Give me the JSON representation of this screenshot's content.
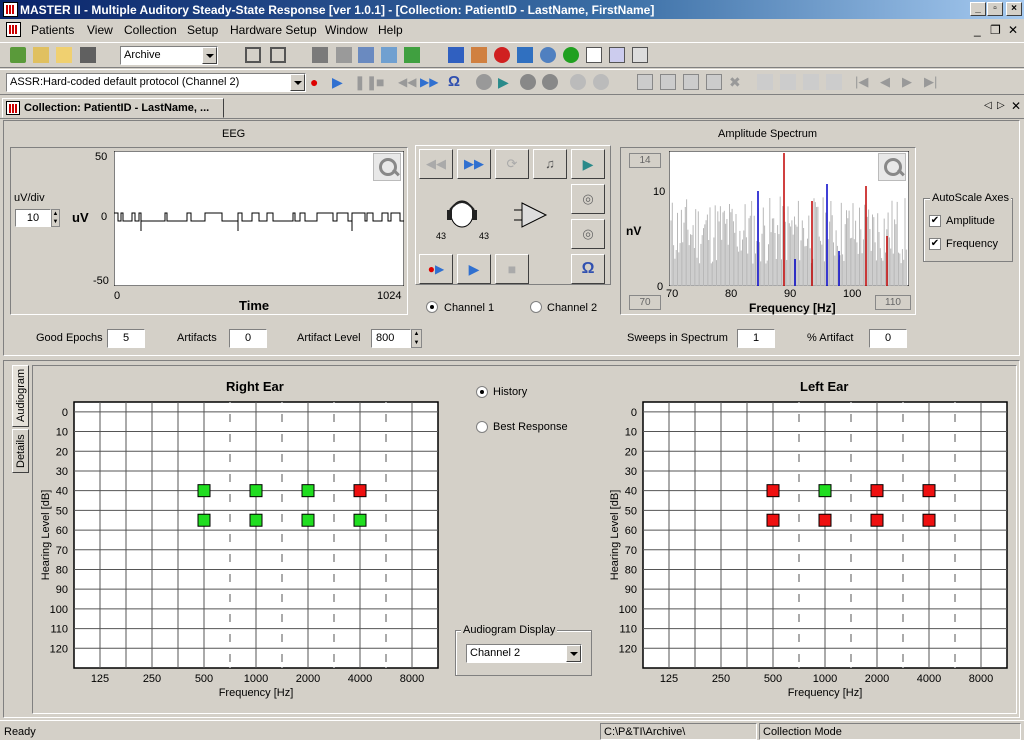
{
  "window": {
    "title": "MASTER II - Multiple Auditory Steady-State Response [ver 1.0.1] - [Collection: PatientID - LastName, FirstName]"
  },
  "menu": [
    "Patients",
    "View",
    "Collection",
    "Setup",
    "Hardware Setup",
    "Window",
    "Help"
  ],
  "toolbar": {
    "mode": "Archive",
    "protocol": "ASSR:Hard-coded default protocol (Channel 2)"
  },
  "doc_tab": "Collection: PatientID - LastName, ...",
  "eeg": {
    "title": "EEG",
    "uv_div_label": "uV/div",
    "uv_div_value": "10",
    "y_unit": "uV",
    "y_ticks": [
      "50",
      "0",
      "-50"
    ],
    "x_min": "0",
    "x_max": "1024",
    "x_label": "Time"
  },
  "stim": {
    "left_level": "43",
    "right_level": "43",
    "channel1": "Channel 1",
    "channel2": "Channel 2",
    "selected_channel": 1
  },
  "spectrum": {
    "title": "Amplitude Spectrum",
    "y_unit": "nV",
    "box_top": "14",
    "box_bottom": "70",
    "box_right": "110",
    "y_ticks": [
      "10",
      "0"
    ],
    "x_ticks": [
      "70",
      "80",
      "90",
      "100"
    ],
    "x_label": "Frequency [Hz]"
  },
  "autoscale": {
    "title": "AutoScale Axes",
    "amplitude": "Amplitude",
    "frequency": "Frequency",
    "amplitude_checked": true,
    "frequency_checked": true
  },
  "stats": {
    "good_epochs_label": "Good Epochs",
    "good_epochs": "5",
    "artifacts_label": "Artifacts",
    "artifacts": "0",
    "artifact_level_label": "Artifact Level",
    "artifact_level": "800",
    "sweeps_label": "Sweeps in Spectrum",
    "sweeps": "1",
    "pct_artifact_label": "% Artifact",
    "pct_artifact": "0"
  },
  "side_tabs": [
    "Audiogram",
    "Details"
  ],
  "audiogram": {
    "right_title": "Right Ear",
    "left_title": "Left Ear",
    "right_color": "#d00000",
    "left_color": "#0000c8",
    "y_ticks": [
      "0",
      "10",
      "20",
      "30",
      "40",
      "50",
      "60",
      "70",
      "80",
      "90",
      "100",
      "110",
      "120"
    ],
    "x_ticks": [
      "125",
      "250",
      "500",
      "1000",
      "2000",
      "4000",
      "8000"
    ],
    "y_label": "Hearing Level [dB]",
    "x_label": "Frequency [Hz]",
    "right_points": [
      {
        "freq": "500",
        "db": 40,
        "status": "green"
      },
      {
        "freq": "1000",
        "db": 40,
        "status": "green"
      },
      {
        "freq": "2000",
        "db": 40,
        "status": "green"
      },
      {
        "freq": "4000",
        "db": 40,
        "status": "red"
      },
      {
        "freq": "500",
        "db": 55,
        "status": "green"
      },
      {
        "freq": "1000",
        "db": 55,
        "status": "green"
      },
      {
        "freq": "2000",
        "db": 55,
        "status": "green"
      },
      {
        "freq": "4000",
        "db": 55,
        "status": "green"
      }
    ],
    "left_points": [
      {
        "freq": "500",
        "db": 40,
        "status": "red"
      },
      {
        "freq": "1000",
        "db": 40,
        "status": "green"
      },
      {
        "freq": "2000",
        "db": 40,
        "status": "red"
      },
      {
        "freq": "4000",
        "db": 40,
        "status": "red"
      },
      {
        "freq": "500",
        "db": 55,
        "status": "red"
      },
      {
        "freq": "1000",
        "db": 55,
        "status": "red"
      },
      {
        "freq": "2000",
        "db": 55,
        "status": "red"
      },
      {
        "freq": "4000",
        "db": 55,
        "status": "red"
      }
    ],
    "history_label": "History",
    "best_response_label": "Best Response",
    "display_label": "Audiogram Display",
    "display_value": "Channel 2"
  },
  "status": {
    "ready": "Ready",
    "path": "C:\\P&TI\\Archive\\",
    "mode": "Collection Mode"
  }
}
